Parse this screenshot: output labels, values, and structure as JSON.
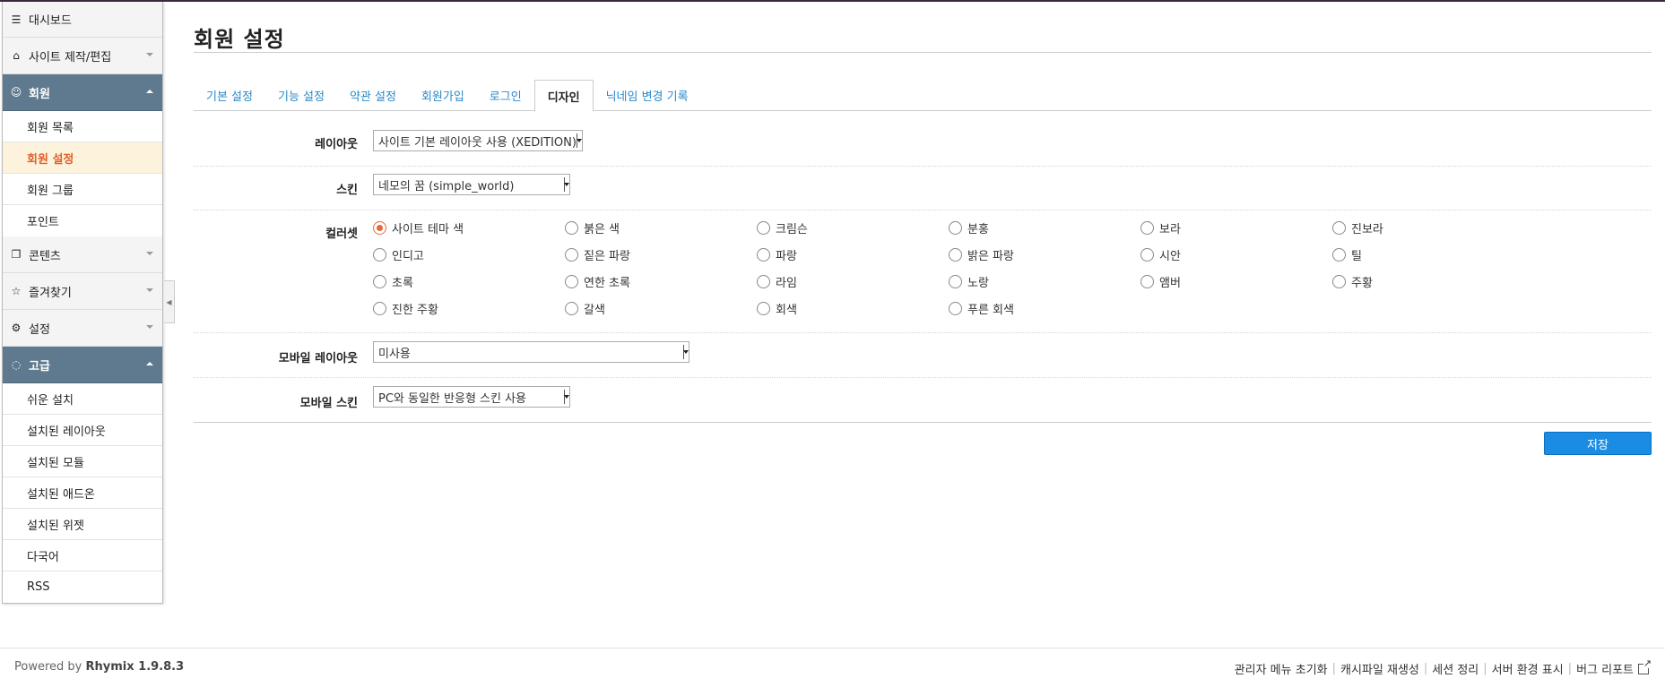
{
  "sidebar": {
    "dashboard": "대시보드",
    "site_edit": "사이트 제작/편집",
    "member": "회원",
    "member_items": [
      "회원 목록",
      "회원 설정",
      "회원 그룹",
      "포인트"
    ],
    "content": "콘텐츠",
    "favorites": "즐겨찾기",
    "settings": "설정",
    "advanced": "고급",
    "advanced_items": [
      "쉬운 설치",
      "설치된 레이아웃",
      "설치된 모듈",
      "설치된 애드온",
      "설치된 위젯",
      "다국어",
      "RSS"
    ]
  },
  "page": {
    "title": "회원 설정",
    "tabs": [
      "기본 설정",
      "기능 설정",
      "약관 설정",
      "회원가입",
      "로그인",
      "디자인",
      "닉네임 변경 기록"
    ],
    "active_tab": "디자인"
  },
  "form": {
    "layout_label": "레이아웃",
    "layout_value": "사이트 기본 레이아웃 사용 (XEDITION)",
    "skin_label": "스킨",
    "skin_value": "네모의 꿈 (simple_world)",
    "colorset_label": "컬러셋",
    "colorsets": [
      "사이트 테마 색",
      "붉은 색",
      "크림슨",
      "분홍",
      "보라",
      "진보라",
      "인디고",
      "짙은 파랑",
      "파랑",
      "밝은 파랑",
      "시안",
      "틸",
      "초록",
      "연한 초록",
      "라임",
      "노랑",
      "앰버",
      "주황",
      "진한 주황",
      "갈색",
      "회색",
      "푸른 회색"
    ],
    "colorset_selected": "사이트 테마 색",
    "mobile_layout_label": "모바일 레이아웃",
    "mobile_layout_value": "미사용",
    "mobile_skin_label": "모바일 스킨",
    "mobile_skin_value": "PC와 동일한 반응형 스킨 사용",
    "save_label": "저장"
  },
  "footer": {
    "powered_prefix": "Powered by",
    "powered_brand": "Rhymix 1.9.8.3",
    "links": [
      "관리자 메뉴 초기화",
      "캐시파일 재생성",
      "세션 정리",
      "서버 환경 표시",
      "버그 리포트"
    ]
  },
  "colors": {
    "accent": "#1b8ce3",
    "sidebar_active": "#5f7a8e",
    "selected_text": "#e0602a",
    "radio_checked": "#e8683a",
    "tab_link": "#2a88c8"
  },
  "icons": [
    "menu-icon",
    "home-icon",
    "users-icon",
    "copy-icon",
    "star-icon",
    "gear-icon",
    "bulb-icon",
    "external-link-icon"
  ]
}
